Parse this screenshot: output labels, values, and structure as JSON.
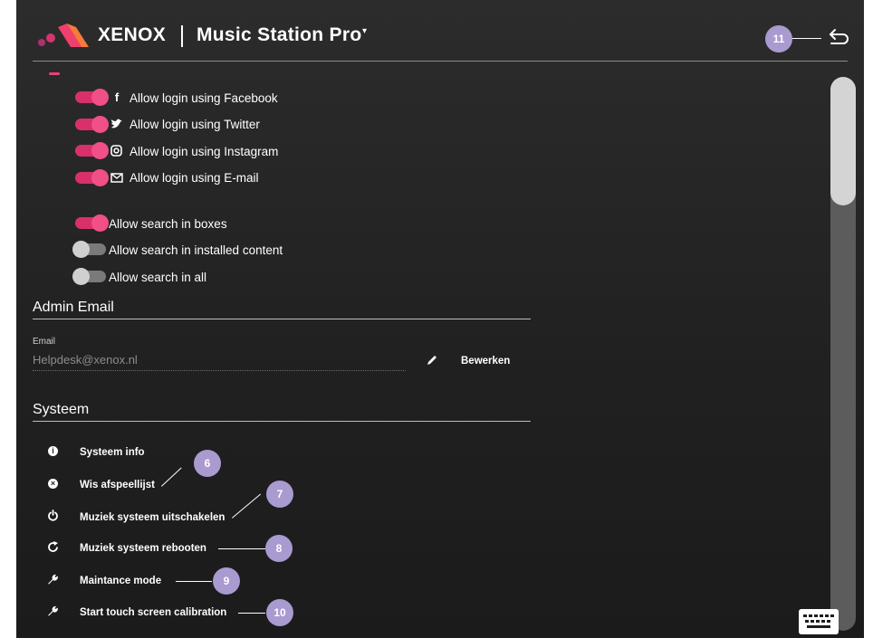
{
  "header": {
    "brand": "XENOX",
    "app_title": "Music Station Pro",
    "caret": "▾",
    "back_badge": "11"
  },
  "login_options": [
    {
      "label": "Allow login using Facebook",
      "icon": "facebook-icon",
      "enabled": true
    },
    {
      "label": "Allow login using Twitter",
      "icon": "twitter-icon",
      "enabled": true
    },
    {
      "label": "Allow login using Instagram",
      "icon": "instagram-icon",
      "enabled": true
    },
    {
      "label": "Allow login using E-mail",
      "icon": "mail-icon",
      "enabled": true
    }
  ],
  "search_options": [
    {
      "label": "Allow search in boxes",
      "enabled": true
    },
    {
      "label": "Allow search in installed content",
      "enabled": false
    },
    {
      "label": "Allow search in all",
      "enabled": false
    }
  ],
  "admin_email": {
    "title": "Admin Email",
    "field_label": "Email",
    "value": "Helpdesk@xenox.nl",
    "edit_label": "Bewerken"
  },
  "system": {
    "title": "Systeem",
    "items": [
      {
        "label": "Systeem info",
        "icon": "info-icon",
        "badge": ""
      },
      {
        "label": "Wis afspeellijst",
        "icon": "clear-icon",
        "badge": "6"
      },
      {
        "label": "Muziek systeem uitschakelen",
        "icon": "power-icon",
        "badge": "7"
      },
      {
        "label": "Muziek systeem rebooten",
        "icon": "reboot-icon",
        "badge": "8"
      },
      {
        "label": "Maintance mode",
        "icon": "wrench-icon",
        "badge": "9"
      },
      {
        "label": "Start touch screen calibration",
        "icon": "wrench-icon",
        "badge": "10"
      }
    ]
  },
  "colors": {
    "accent": "#e8407a",
    "badge": "#a99ad0",
    "background": "#242424"
  }
}
